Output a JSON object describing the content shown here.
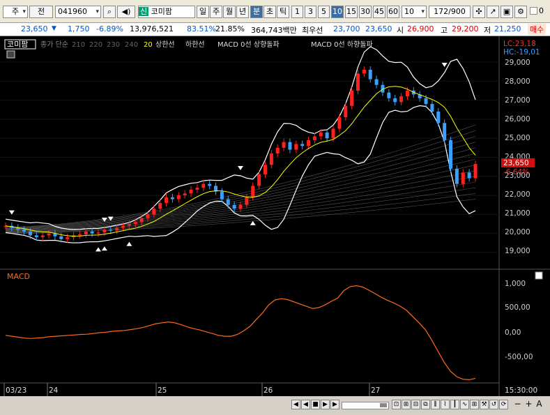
{
  "toolbar": {
    "market": "주",
    "prev_btn": "전",
    "code": "041960",
    "new_badge": "신",
    "stock_name": "코미팜",
    "period_tabs": [
      "일",
      "주",
      "월",
      "년",
      "분",
      "초",
      "틱"
    ],
    "active_period": "분",
    "intervals": [
      "1",
      "3",
      "5",
      "10",
      "15",
      "30",
      "45",
      "60"
    ],
    "active_interval": "10",
    "interval_select": "10",
    "count": "172",
    "count_total": "/900",
    "check_label": "0",
    "check_label2": "0"
  },
  "quote": {
    "price": "23,650",
    "arrow": "▼",
    "change": "1,750",
    "change_pct": "-6.89%",
    "volume": "13,976,521",
    "vol_ratio": "83.51%",
    "turnover": "21.85%",
    "amount": "364,743백만",
    "ma_label": "최우선",
    "best_ask": "23,700",
    "best_bid": "23,650",
    "open_label": "시",
    "open": "26,900",
    "high_label": "고",
    "high": "29,200",
    "low_label": "저",
    "low": "21,250",
    "trade_label": "매수"
  },
  "legend": {
    "name": "코미팜",
    "items": [
      "종가 단순",
      "210",
      "220",
      "230",
      "240",
      "20",
      "상한선",
      "하한선",
      "MACD 0선 상향돌파",
      "MACD 0선 하향돌파"
    ]
  },
  "labels": {
    "lc": "LC:23,18",
    "hc": "HC:-19,01",
    "current_price": "23,650",
    "current_pct": "-6.64%",
    "macd_title": "MACD",
    "time_label": "15:30:00"
  },
  "price_axis": [
    "29,000",
    "28,000",
    "27,000",
    "26,000",
    "25,000",
    "24,000",
    "23,000",
    "22,000",
    "21,000",
    "20,000",
    "19,000"
  ],
  "macd_axis": [
    "1,000",
    "500,00",
    "0,00",
    "-500,00"
  ],
  "x_axis": [
    "03/23",
    "24",
    "25",
    "26",
    "27"
  ],
  "colors": {
    "up": "#ff2020",
    "down": "#3aa0ff",
    "band": "#ffffff",
    "ma20": "#ffff00",
    "macd": "#ff6a1a"
  },
  "chart_data": {
    "type": "line",
    "title": "",
    "price_ylim": [
      18000,
      29700
    ],
    "macd_ylim": [
      -1000,
      1150
    ],
    "x_labels": [
      "03/23",
      "24",
      "25",
      "26",
      "27"
    ],
    "price_close": [
      20400,
      20300,
      20200,
      20100,
      19900,
      19800,
      19900,
      20000,
      19850,
      19700,
      19800,
      19900,
      19950,
      20100,
      20000,
      20050,
      20200,
      20150,
      20300,
      20400,
      20500,
      20600,
      20800,
      21000,
      21300,
      21600,
      21900,
      21800,
      22000,
      22100,
      22300,
      22400,
      22600,
      22500,
      22200,
      21800,
      21500,
      21300,
      21500,
      21900,
      22500,
      23100,
      23600,
      24200,
      24500,
      24800,
      24400,
      24700,
      24600,
      24900,
      25100,
      25300,
      25000,
      25500,
      26100,
      26700,
      27500,
      28400,
      28600,
      28100,
      27800,
      27400,
      27100,
      26900,
      27200,
      27500,
      27300,
      27100,
      26800,
      26400,
      25800,
      24900,
      23400,
      22600,
      23200,
      22900,
      23650
    ],
    "macd_values": [
      0,
      -20,
      -40,
      -60,
      -70,
      -60,
      -50,
      -30,
      -20,
      -10,
      0,
      10,
      20,
      25,
      40,
      60,
      70,
      90,
      100,
      110,
      130,
      150,
      180,
      220,
      260,
      280,
      300,
      280,
      240,
      190,
      150,
      120,
      80,
      40,
      0,
      -20,
      -20,
      20,
      100,
      200,
      350,
      500,
      680,
      790,
      820,
      800,
      750,
      700,
      650,
      600,
      620,
      680,
      760,
      830,
      1000,
      1090,
      1110,
      1080,
      1010,
      930,
      850,
      780,
      720,
      650,
      560,
      420,
      280,
      130,
      -100,
      -350,
      -600,
      -800,
      -920,
      -980,
      -990,
      -960
    ],
    "series": [
      {
        "name": "20",
        "color": "#ffff00"
      },
      {
        "name": "상한선",
        "color": "#ffffff"
      },
      {
        "name": "하한선",
        "color": "#ffffff"
      },
      {
        "name": "MACD",
        "color": "#ff6a1a"
      }
    ]
  }
}
